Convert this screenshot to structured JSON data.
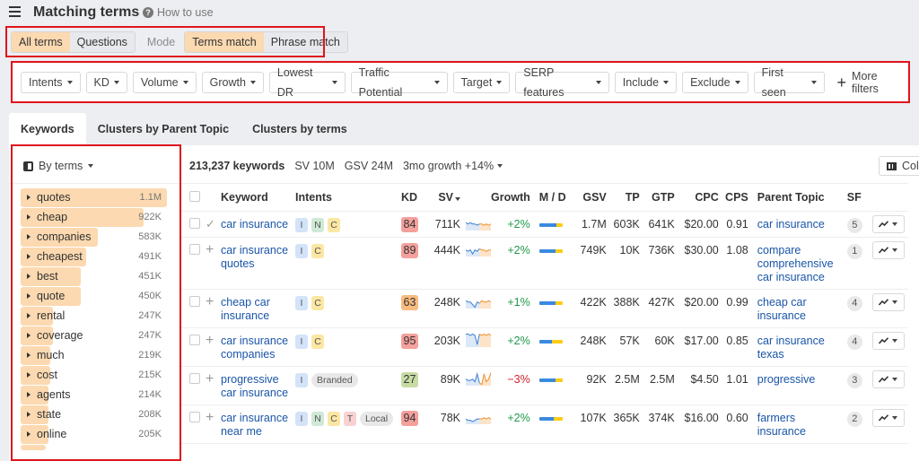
{
  "header": {
    "title": "Matching terms",
    "how_to_use": "How to use"
  },
  "modes": {
    "scope": [
      {
        "label": "All terms",
        "active": true
      },
      {
        "label": "Questions",
        "active": false
      }
    ],
    "mode_label": "Mode",
    "match": [
      {
        "label": "Terms match",
        "active": true
      },
      {
        "label": "Phrase match",
        "active": false
      }
    ]
  },
  "filters": [
    "Intents",
    "KD",
    "Volume",
    "Growth",
    "Lowest DR",
    "Traffic Potential",
    "Target",
    "SERP features",
    "Include",
    "Exclude",
    "First seen"
  ],
  "more_filters": "More filters",
  "tabs": [
    {
      "label": "Keywords",
      "active": true
    },
    {
      "label": "Clusters by Parent Topic",
      "active": false
    },
    {
      "label": "Clusters by terms",
      "active": false
    }
  ],
  "sidebar": {
    "group_by": "By terms",
    "terms": [
      {
        "name": "quotes",
        "count": "1.1M",
        "share": 1.0
      },
      {
        "name": "cheap",
        "count": "922K",
        "share": 0.84
      },
      {
        "name": "companies",
        "count": "583K",
        "share": 0.53
      },
      {
        "name": "cheapest",
        "count": "491K",
        "share": 0.45
      },
      {
        "name": "best",
        "count": "451K",
        "share": 0.41
      },
      {
        "name": "quote",
        "count": "450K",
        "share": 0.41
      },
      {
        "name": "rental",
        "count": "247K",
        "share": 0.22
      },
      {
        "name": "coverage",
        "count": "247K",
        "share": 0.22
      },
      {
        "name": "much",
        "count": "219K",
        "share": 0.2
      },
      {
        "name": "cost",
        "count": "215K",
        "share": 0.2
      },
      {
        "name": "agents",
        "count": "214K",
        "share": 0.19
      },
      {
        "name": "state",
        "count": "208K",
        "share": 0.19
      },
      {
        "name": "online",
        "count": "205K",
        "share": 0.19
      }
    ]
  },
  "summary": {
    "keywords": "213,237 keywords",
    "sv": "SV 10M",
    "gsv": "GSV 24M",
    "growth": "3mo growth +14%",
    "columns_button": "Col"
  },
  "table": {
    "headers": [
      "Keyword",
      "Intents",
      "KD",
      "SV",
      "Growth",
      "M / D",
      "GSV",
      "TP",
      "GTP",
      "CPC",
      "CPS",
      "Parent Topic",
      "SF"
    ],
    "rows": [
      {
        "keyword": "car insurance",
        "added": true,
        "intents": [
          "I",
          "N",
          "C"
        ],
        "tags": [],
        "kd": "84",
        "kd_color": "#f4a09c",
        "sv": "711K",
        "growth": "+2%",
        "growth_dir": "pos",
        "mobile_share": 0.75,
        "gsv": "1.7M",
        "tp": "603K",
        "gtp": "641K",
        "cpc": "$20.00",
        "cps": "0.91",
        "parent_topic": "car insurance",
        "sf": "5",
        "spark": [
          6,
          5,
          6,
          5,
          5,
          4,
          5,
          5,
          4,
          5,
          4,
          5
        ]
      },
      {
        "keyword": "car insurance quotes",
        "added": false,
        "intents": [
          "I",
          "C"
        ],
        "tags": [],
        "kd": "89",
        "kd_color": "#f4a09c",
        "sv": "444K",
        "growth": "+2%",
        "growth_dir": "pos",
        "mobile_share": 0.72,
        "gsv": "749K",
        "tp": "10K",
        "gtp": "736K",
        "cpc": "$30.00",
        "cps": "1.08",
        "parent_topic": "compare comprehensive car insurance",
        "sf": "1",
        "spark": [
          5,
          4,
          5,
          2,
          5,
          4,
          6,
          5,
          5,
          4,
          5,
          5
        ]
      },
      {
        "keyword": "cheap car insurance",
        "added": false,
        "intents": [
          "I",
          "C"
        ],
        "tags": [],
        "kd": "63",
        "kd_color": "#f9bb80",
        "sv": "248K",
        "growth": "+1%",
        "growth_dir": "pos",
        "mobile_share": 0.72,
        "gsv": "422K",
        "tp": "388K",
        "gtp": "427K",
        "cpc": "$20.00",
        "cps": "0.99",
        "parent_topic": "cheap car insurance",
        "sf": "4",
        "spark": [
          6,
          5,
          5,
          3,
          1,
          5,
          4,
          6,
          5,
          5,
          6,
          5
        ]
      },
      {
        "keyword": "car insurance companies",
        "added": false,
        "intents": [
          "I",
          "C"
        ],
        "tags": [],
        "kd": "95",
        "kd_color": "#f4a09c",
        "sv": "203K",
        "growth": "+2%",
        "growth_dir": "pos",
        "mobile_share": 0.55,
        "gsv": "248K",
        "tp": "57K",
        "gtp": "60K",
        "cpc": "$17.00",
        "cps": "0.85",
        "parent_topic": "car insurance texas",
        "sf": "4",
        "spark": [
          10,
          10,
          9,
          10,
          9,
          2,
          10,
          9,
          10,
          9,
          10,
          9
        ]
      },
      {
        "keyword": "progressive car insurance",
        "added": false,
        "intents": [
          "I"
        ],
        "tags": [
          "Branded"
        ],
        "kd": "27",
        "kd_color": "#c6dca3",
        "sv": "89K",
        "growth": "−3%",
        "growth_dir": "neg",
        "mobile_share": 0.72,
        "gsv": "92K",
        "tp": "2.5M",
        "gtp": "2.5M",
        "cpc": "$4.50",
        "cps": "1.01",
        "parent_topic": "progressive",
        "sf": "3",
        "spark": [
          5,
          4,
          4,
          5,
          3,
          9,
          2,
          1,
          9,
          3,
          5,
          10
        ]
      },
      {
        "keyword": "car insurance near me",
        "added": false,
        "intents": [
          "I",
          "N",
          "C",
          "T"
        ],
        "tags": [
          "Local"
        ],
        "kd": "94",
        "kd_color": "#f4a09c",
        "sv": "78K",
        "growth": "+2%",
        "growth_dir": "pos",
        "mobile_share": 0.62,
        "gsv": "107K",
        "tp": "365K",
        "gtp": "374K",
        "cpc": "$16.00",
        "cps": "0.60",
        "parent_topic": "farmers insurance",
        "sf": "2",
        "spark": [
          4,
          3,
          3,
          2,
          3,
          4,
          4,
          4,
          5,
          4,
          5,
          4
        ]
      }
    ]
  },
  "colors": {
    "accent": "#fbd9b1",
    "highlight_box": "#e0141c",
    "link": "#1a55a8"
  }
}
